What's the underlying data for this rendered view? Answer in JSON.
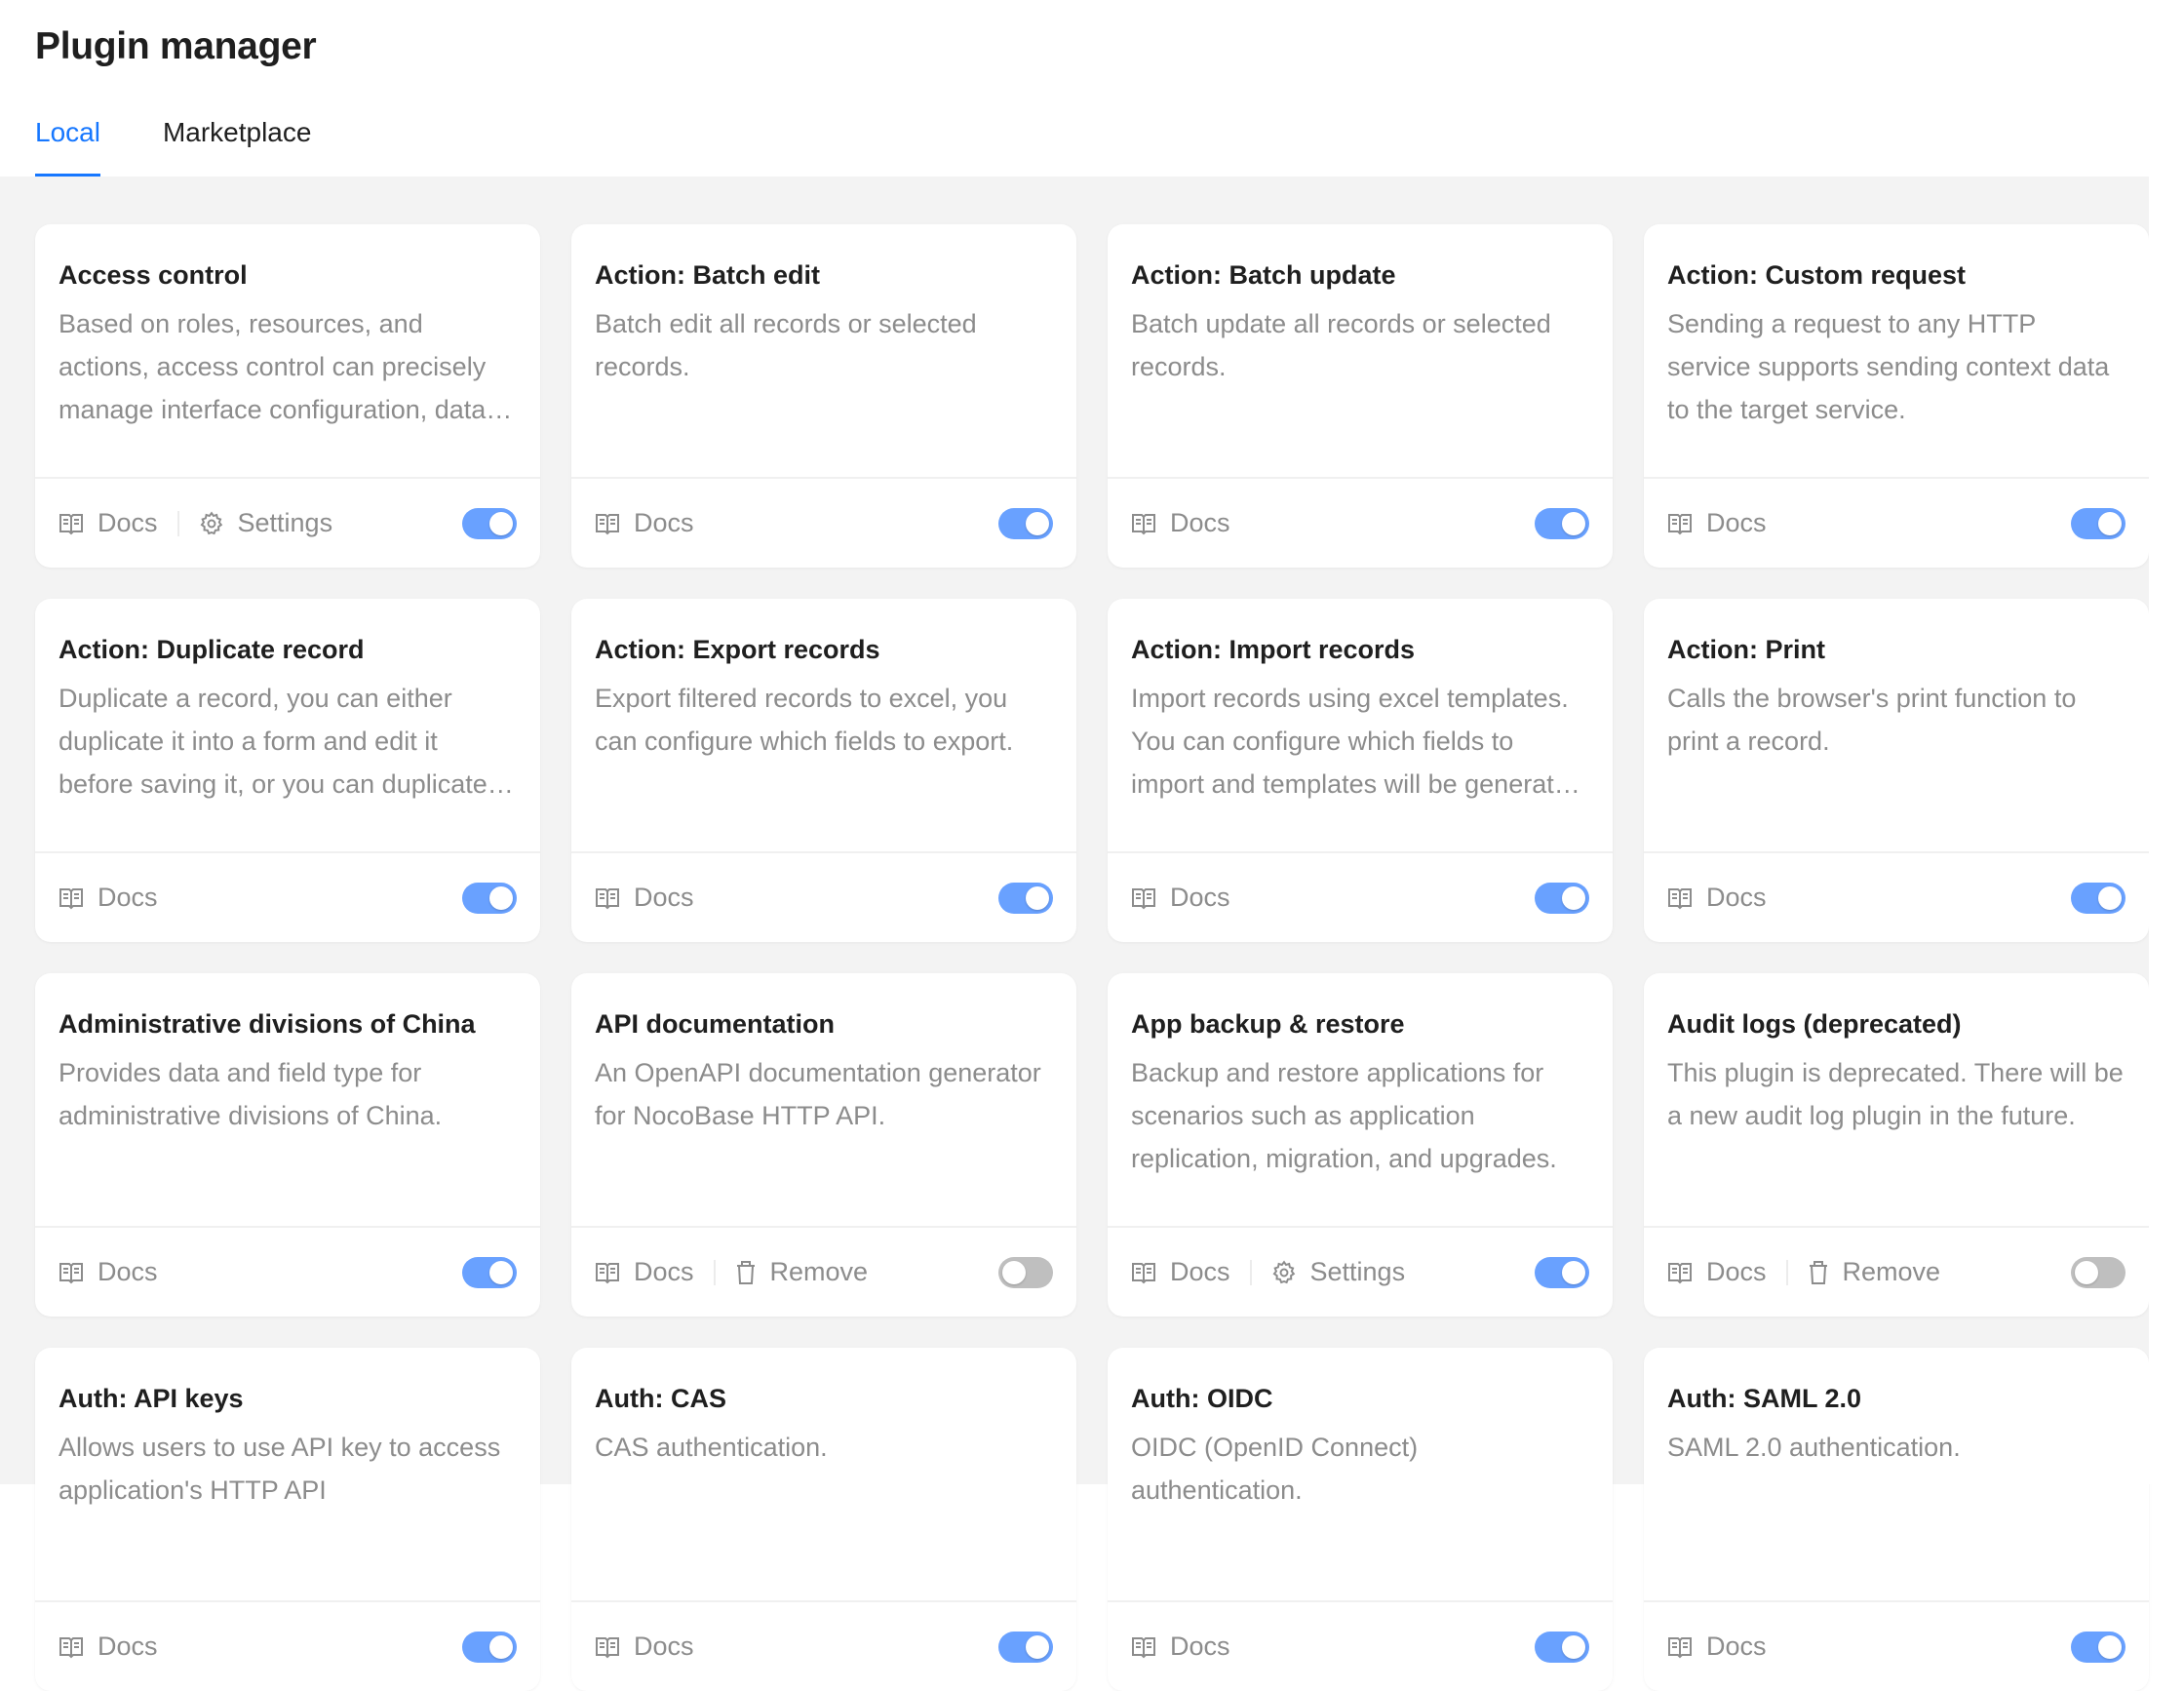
{
  "header": {
    "title": "Plugin manager",
    "tabs": [
      {
        "label": "Local",
        "active": true
      },
      {
        "label": "Marketplace",
        "active": false
      }
    ]
  },
  "colors": {
    "accent": "#1677ff",
    "toggle_on": "#69a1ff",
    "toggle_off": "#bfbfbf",
    "background": "#f3f3f3"
  },
  "labels": {
    "docs": "Docs",
    "settings": "Settings",
    "remove": "Remove"
  },
  "plugins": [
    {
      "title": "Access control",
      "description": "Based on roles, resources, and actions, access control can precisely manage interface configuration, data operation permissions, menu access permissions, and plugin permissions.",
      "actions": [
        "docs",
        "settings"
      ],
      "enabled": true
    },
    {
      "title": "Action: Batch edit",
      "description": "Batch edit all records or selected records.",
      "actions": [
        "docs"
      ],
      "enabled": true
    },
    {
      "title": "Action: Batch update",
      "description": "Batch update all records or selected records.",
      "actions": [
        "docs"
      ],
      "enabled": true
    },
    {
      "title": "Action: Custom request",
      "description": "Sending a request to any HTTP service supports sending context data to the target service.",
      "actions": [
        "docs"
      ],
      "enabled": true
    },
    {
      "title": "Action: Duplicate record",
      "description": "Duplicate a record, you can either duplicate it into a form and edit it before saving it, or you can duplicate it directly.",
      "actions": [
        "docs"
      ],
      "enabled": true
    },
    {
      "title": "Action: Export records",
      "description": "Export filtered records to excel, you can configure which fields to export.",
      "actions": [
        "docs"
      ],
      "enabled": true
    },
    {
      "title": "Action: Import records",
      "description": "Import records using excel templates. You can configure which fields to import and templates will be generated automatically.",
      "actions": [
        "docs"
      ],
      "enabled": true
    },
    {
      "title": "Action: Print",
      "description": "Calls the browser's print function to print a record.",
      "actions": [
        "docs"
      ],
      "enabled": true
    },
    {
      "title": "Administrative divisions of China",
      "description": "Provides data and field type for administrative divisions of China.",
      "actions": [
        "docs"
      ],
      "enabled": true
    },
    {
      "title": "API documentation",
      "description": "An OpenAPI documentation generator for NocoBase HTTP API.",
      "actions": [
        "docs",
        "remove"
      ],
      "enabled": false
    },
    {
      "title": "App backup & restore",
      "description": "Backup and restore applications for scenarios such as application replication, migration, and upgrades.",
      "actions": [
        "docs",
        "settings"
      ],
      "enabled": true
    },
    {
      "title": "Audit logs (deprecated)",
      "description": "This plugin is deprecated. There will be a new audit log plugin in the future.",
      "actions": [
        "docs",
        "remove"
      ],
      "enabled": false
    },
    {
      "title": "Auth: API keys",
      "description": "Allows users to use API key to access application's HTTP API",
      "actions": [
        "docs"
      ],
      "enabled": true
    },
    {
      "title": "Auth: CAS",
      "description": "CAS authentication.",
      "actions": [
        "docs"
      ],
      "enabled": true
    },
    {
      "title": "Auth: OIDC",
      "description": "OIDC (OpenID Connect) authentication.",
      "actions": [
        "docs"
      ],
      "enabled": true
    },
    {
      "title": "Auth: SAML 2.0",
      "description": "SAML 2.0 authentication.",
      "actions": [
        "docs"
      ],
      "enabled": true
    }
  ]
}
